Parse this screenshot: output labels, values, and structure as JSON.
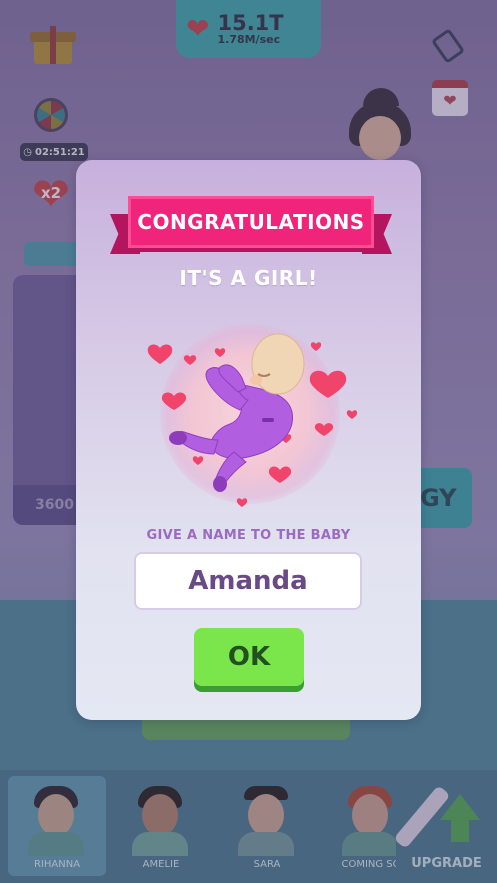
{
  "hud": {
    "currency_total": "15.1T",
    "currency_rate": "1.78M/sec",
    "wheel_timer": "02:51:21",
    "multiplier_label": "x2"
  },
  "background": {
    "left_card_price": "3600",
    "right_button_fragment": "GY"
  },
  "modal": {
    "banner_title": "CONGRATULATIONS",
    "subtitle": "IT'S A GIRL!",
    "name_prompt": "GIVE A NAME TO THE BABY",
    "name_value": "Amanda",
    "ok_label": "OK"
  },
  "characters": [
    {
      "name": "RIHANNA"
    },
    {
      "name": "AMELIE"
    },
    {
      "name": "SARA"
    },
    {
      "name": "COMING SO"
    }
  ],
  "upgrade_label": "UPGRADE",
  "colors": {
    "banner": "#f0247b",
    "ok_button": "#7be64c",
    "prompt_text": "#9a6bbf",
    "baby_suit": "#b25ee0"
  }
}
